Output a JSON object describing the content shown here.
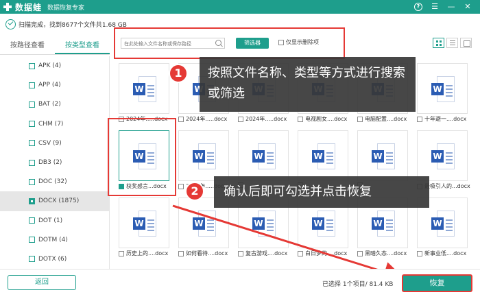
{
  "app": {
    "name": "数据蛙",
    "subtitle": "数据恢复专家",
    "brand_color": "#1e9e8c"
  },
  "status": {
    "text": "扫描完成，找到8677个文件共1.68 GB"
  },
  "tabs": [
    {
      "label": "按路径查看",
      "active": false
    },
    {
      "label": "按类型查看",
      "active": true
    }
  ],
  "sidebar": {
    "items": [
      {
        "label": "APK (4)",
        "checked": false,
        "active": false
      },
      {
        "label": "APP (4)",
        "checked": false,
        "active": false
      },
      {
        "label": "BAT (2)",
        "checked": false,
        "active": false
      },
      {
        "label": "CHM (7)",
        "checked": false,
        "active": false
      },
      {
        "label": "CSV (9)",
        "checked": false,
        "active": false
      },
      {
        "label": "DB3 (2)",
        "checked": false,
        "active": false
      },
      {
        "label": "DOC (32)",
        "checked": false,
        "active": false
      },
      {
        "label": "DOCX (1875)",
        "checked": true,
        "active": true
      },
      {
        "label": "DOT (1)",
        "checked": false,
        "active": false
      },
      {
        "label": "DOTM (4)",
        "checked": false,
        "active": false
      },
      {
        "label": "DOTX (6)",
        "checked": false,
        "active": false
      }
    ]
  },
  "filter": {
    "search_placeholder": "在此处输入文件名称或保存路径",
    "filter_button": "筛选器",
    "deleted_only_label": "仅显示删除项"
  },
  "files": {
    "row1": [
      "2024年.....docx",
      "2024年.....docx",
      "2024年.....docx",
      "电视剧女....docx",
      "电脑配置....docx",
      "十年避一....docx"
    ],
    "row2": [
      "获奖感言...docx",
      "2024年.....docx",
      "",
      "",
      "",
      "最吸引人的...docx"
    ],
    "row3": [
      "历史上的....docx",
      "如何看待....docx",
      "复古游戏....docx",
      "白日梦的....docx",
      "黑暗久态....docx",
      "新事业低....docx"
    ],
    "selected": "获奖感言...docx"
  },
  "annotations": {
    "step1_number": "1",
    "step1_text": "按照文件名称、类型等方式进行搜索或筛选",
    "step2_number": "2",
    "step2_text": "确认后即可勾选并点击恢复"
  },
  "footer": {
    "back_label": "返回",
    "selection_text": "已选择 1个项目/ 81.4 KB",
    "recover_label": "恢复"
  }
}
